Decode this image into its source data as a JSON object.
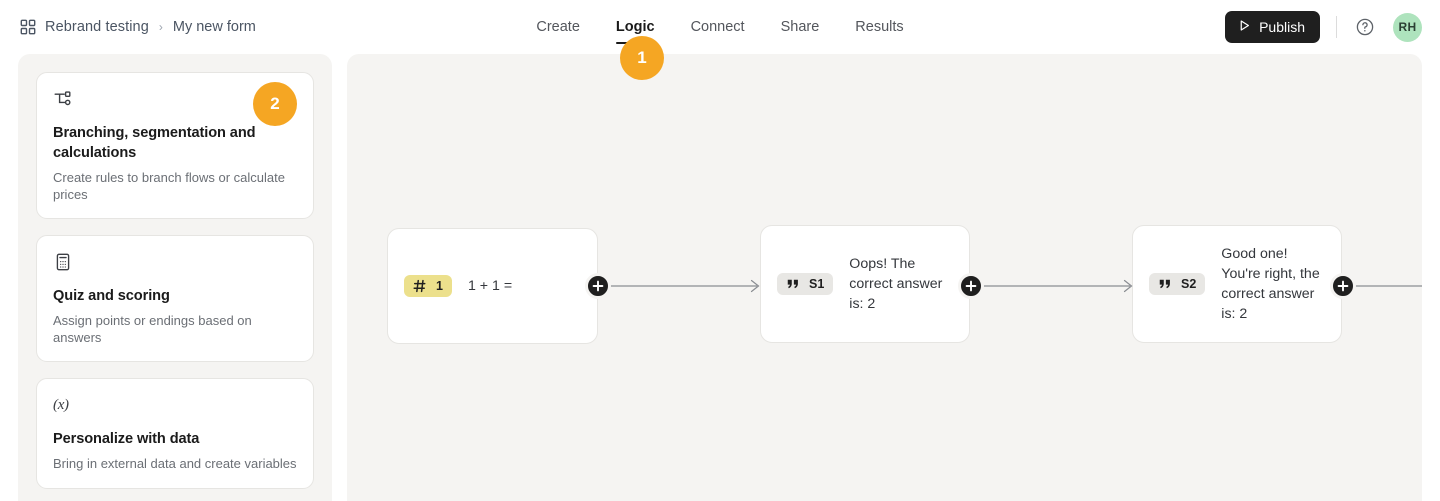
{
  "header": {
    "breadcrumb": {
      "grid_icon": "grid-icon",
      "workspace": "Rebrand testing",
      "separator": "›",
      "current": "My new form"
    },
    "tabs": [
      {
        "label": "Create",
        "active": false
      },
      {
        "label": "Logic",
        "active": true
      },
      {
        "label": "Connect",
        "active": false
      },
      {
        "label": "Share",
        "active": false
      },
      {
        "label": "Results",
        "active": false
      }
    ],
    "publish": {
      "label": "Publish",
      "icon": "play-icon"
    },
    "help_icon": "help-circle-icon",
    "avatar": {
      "initials": "RH",
      "color": "#aee3bd"
    }
  },
  "step_badges": [
    {
      "number": "1",
      "target": "logic-tab"
    },
    {
      "number": "2",
      "target": "branching-card"
    }
  ],
  "sidebar": {
    "cards": [
      {
        "icon": "branch-icon",
        "title": "Branching, segmentation and calculations",
        "description": "Create rules to branch flows or calculate prices"
      },
      {
        "icon": "calculator-icon",
        "title": "Quiz and scoring",
        "description": "Assign points or endings based on answers"
      },
      {
        "icon": "variable-icon",
        "icon_text": "(x)",
        "title": "Personalize with data",
        "description": "Bring in external data and create variables"
      }
    ]
  },
  "canvas": {
    "nodes": [
      {
        "chip_style": "yellow",
        "chip_icon": "hash-icon",
        "chip_label": "1",
        "text": "1 + 1 ="
      },
      {
        "chip_style": "grey",
        "chip_icon": "quote-icon",
        "chip_label": "S1",
        "text": "Oops! The correct answer is: 2"
      },
      {
        "chip_style": "grey",
        "chip_icon": "quote-icon",
        "chip_label": "S2",
        "text": "Good one! You're right, the correct answer is: 2"
      }
    ],
    "add_handle_icon": "plus-icon"
  },
  "colors": {
    "accent_badge": "#F5A623",
    "chip_yellow": "#ECE08C",
    "chip_grey": "#E8E7E4",
    "panel_bg": "#F5F4F2",
    "publish_bg": "#1F1F1F",
    "avatar_bg": "#AEE3BD"
  }
}
